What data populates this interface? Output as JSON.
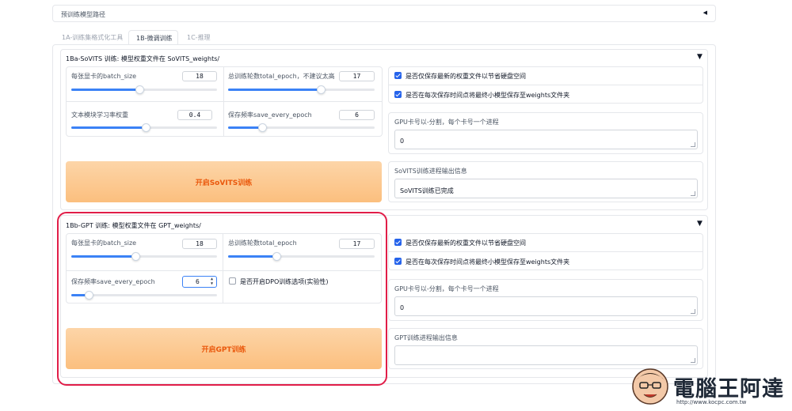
{
  "top_accordion": {
    "title": "预训练模型路径",
    "icon": "triangle-left-icon"
  },
  "tabs": [
    {
      "label": "1A-训练集格式化工具",
      "active": false
    },
    {
      "label": "1B-微调训练",
      "active": true
    },
    {
      "label": "1C-推理",
      "active": false
    }
  ],
  "sovits": {
    "title": "1Ba-SoVITS 训练: 模型权重文件在 SoVITS_weights/",
    "batch_label": "每张显卡的batch_size",
    "batch_value": "18",
    "batch_fill": 0.47,
    "epoch_label": "总训练轮数total_epoch，不建议太高",
    "epoch_value": "17",
    "epoch_fill": 0.63,
    "lr_label": "文本模块学习率权重",
    "lr_value": "0.4",
    "lr_fill": 0.47,
    "save_freq_label": "保存频率save_every_epoch",
    "save_freq_value": "6",
    "save_freq_fill": 0.22,
    "save_latest_label": "是否仅保存最新的权重文件以节省硬盘空间",
    "save_small_label": "是否在每次保存时间点将最终小模型保存至weights文件夹",
    "gpu_label": "GPU卡号以-分割，每个卡号一个进程",
    "gpu_value": "0",
    "start_button": "开启SoVITS训练",
    "output_label": "SoVITS训练进程输出信息",
    "output_value": "SoVITS训练已完成"
  },
  "gpt": {
    "title": "1Bb-GPT 训练: 模型权重文件在 GPT_weights/",
    "batch_label": "每张显卡的batch_size",
    "batch_value": "18",
    "batch_fill": 0.44,
    "epoch_label": "总训练轮数total_epoch",
    "epoch_value": "17",
    "epoch_fill": 0.32,
    "save_freq_label": "保存频率save_every_epoch",
    "save_freq_value": "6",
    "save_freq_fill": 0.12,
    "dpo_label": "是否开启DPO训练选项(实验性)",
    "save_latest_label": "是否仅保存最新的权重文件以节省硬盘空间",
    "save_small_label": "是否在每次保存时间点将最终小模型保存至weights文件夹",
    "gpu_label": "GPU卡号以-分割，每个卡号一个进程",
    "gpu_value": "0",
    "start_button": "开启GPT训练",
    "output_label": "GPT训练进程输出信息",
    "output_value": ""
  },
  "watermark": {
    "brand": "電腦王阿達",
    "url": "http://www.kocpc.com.tw"
  },
  "colors": {
    "accent": "#2563eb",
    "highlight": "#e11d48",
    "button_text": "#ea580c"
  }
}
